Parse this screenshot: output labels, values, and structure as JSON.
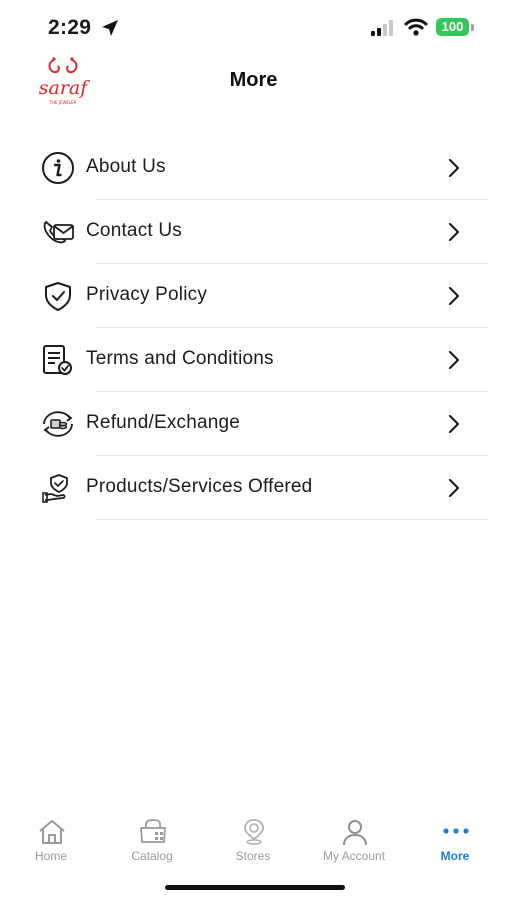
{
  "status_bar": {
    "time": "2:29",
    "battery": "100"
  },
  "header": {
    "logo_text": "saraf",
    "logo_subtext": "THE JEWELER",
    "title": "More"
  },
  "menu": [
    {
      "label": "About Us",
      "icon": "info-icon"
    },
    {
      "label": "Contact Us",
      "icon": "contact-icon"
    },
    {
      "label": "Privacy Policy",
      "icon": "shield-check-icon"
    },
    {
      "label": "Terms and Conditions",
      "icon": "document-check-icon"
    },
    {
      "label": "Refund/Exchange",
      "icon": "refund-icon"
    },
    {
      "label": "Products/Services Offered",
      "icon": "hand-shield-icon"
    }
  ],
  "tab_bar": {
    "tabs": [
      {
        "label": "Home",
        "icon": "home-icon"
      },
      {
        "label": "Catalog",
        "icon": "catalog-icon"
      },
      {
        "label": "Stores",
        "icon": "store-pin-icon"
      },
      {
        "label": "My Account",
        "icon": "user-icon"
      },
      {
        "label": "More",
        "icon": "more-dots-icon",
        "active": true
      }
    ]
  },
  "colors": {
    "accent": "#1a7fd8",
    "brand": "#d42a2a",
    "battery": "#34c759",
    "inactive_tab": "#9a9a9f"
  }
}
